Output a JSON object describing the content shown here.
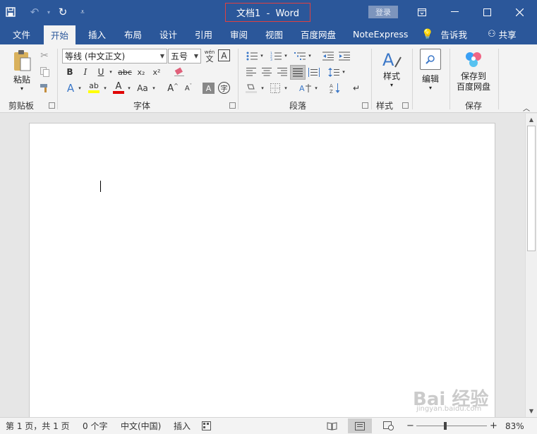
{
  "window": {
    "title": "文档1  -  Word",
    "login_label": "登录",
    "accent": "#2b579a"
  },
  "qat": {
    "save_icon": "save-icon",
    "undo_icon": "undo-icon",
    "redo_icon": "redo-icon",
    "customize_icon": "customize-qat-icon"
  },
  "tabs": [
    "文件",
    "开始",
    "插入",
    "布局",
    "设计",
    "引用",
    "审阅",
    "视图",
    "百度网盘",
    "NoteExpress"
  ],
  "active_tab": "开始",
  "tell_me": "告诉我",
  "share": "共享",
  "ribbon": {
    "clipboard": {
      "paste": "粘贴",
      "label": "剪贴板"
    },
    "font": {
      "font_name": "等线 (中文正文)",
      "font_size": "五号",
      "label": "字体",
      "bold": "B",
      "italic": "I",
      "underline": "U",
      "strike": "abc",
      "subscript": "x₂",
      "superscript": "x²",
      "case": "Aa",
      "grow": "A",
      "shrink": "A",
      "phonetic": "wén",
      "phonetic_char": "文"
    },
    "paragraph": {
      "label": "段落"
    },
    "styles": {
      "button": "样式",
      "label": "样式"
    },
    "editing": {
      "button": "编辑"
    },
    "save": {
      "button_line1": "保存到",
      "button_line2": "百度网盘",
      "label": "保存"
    }
  },
  "statusbar": {
    "page": "第 1 页，共 1 页",
    "words": "0 个字",
    "language": "中文(中国)",
    "mode": "插入",
    "zoom_minus": "−",
    "zoom_plus": "+",
    "zoom": "83%",
    "zoom_fraction": 0.83
  },
  "watermark": {
    "text": "Bai 经验",
    "sub": "jingyan.baidu.com"
  }
}
